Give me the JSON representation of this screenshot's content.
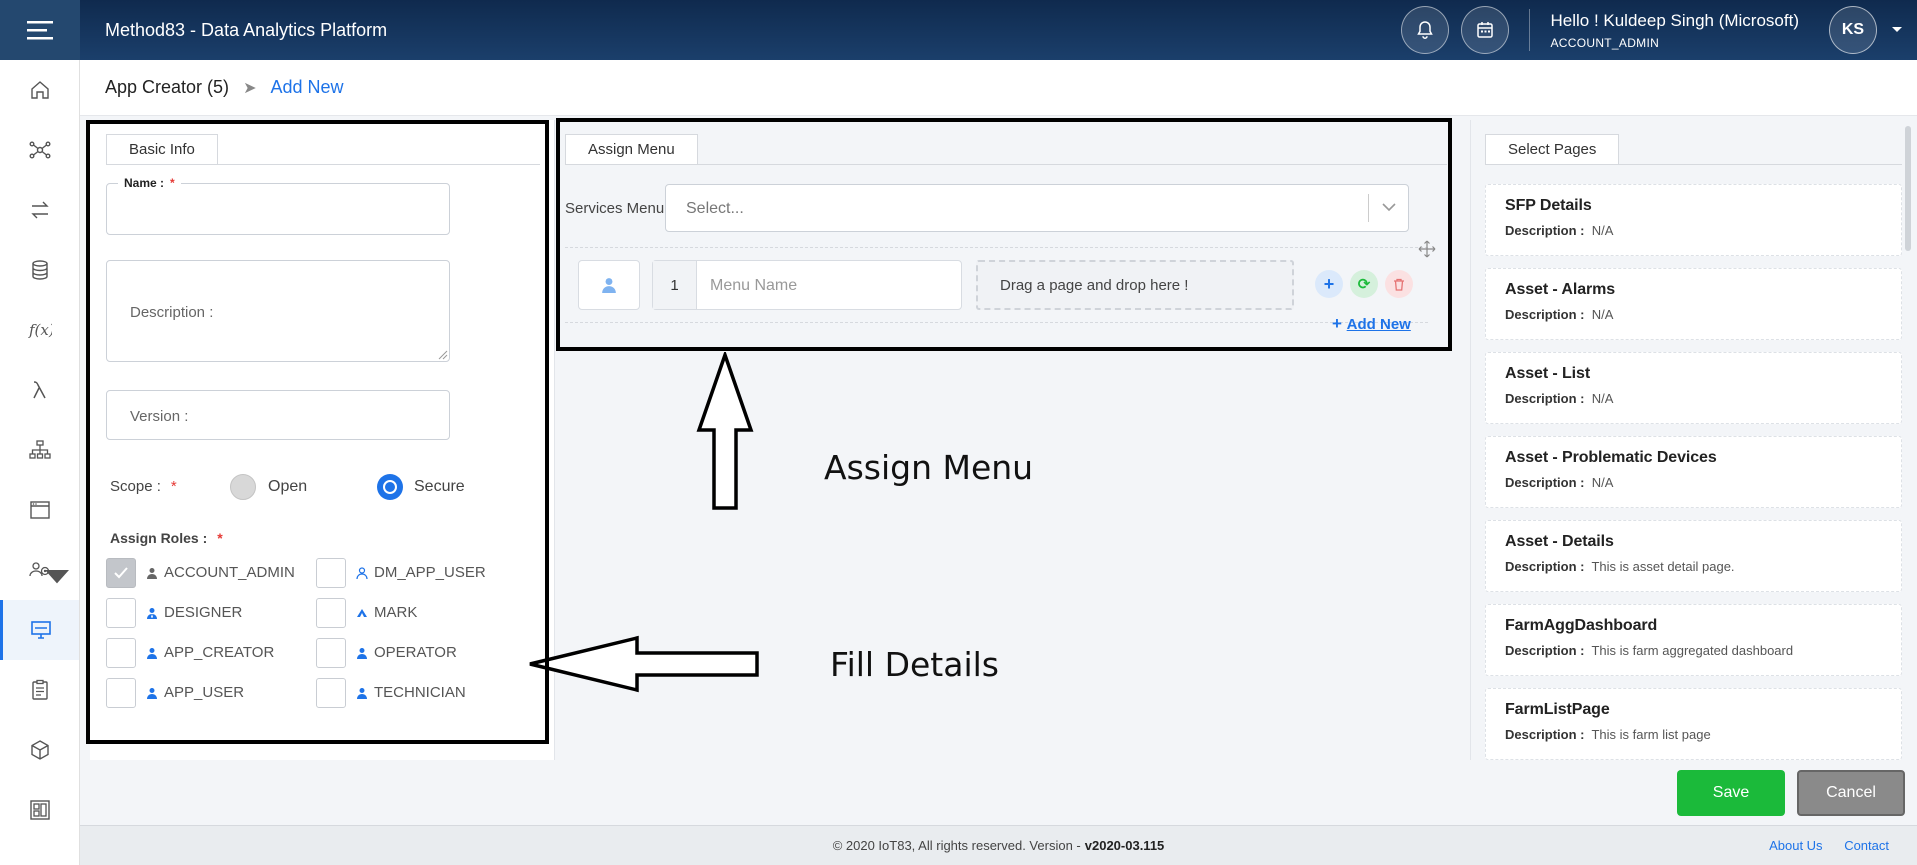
{
  "header": {
    "title": "Method83 - Data Analytics Platform",
    "greeting": "Hello ! Kuldeep Singh (Microsoft)",
    "role": "ACCOUNT_ADMIN",
    "avatar_initials": "KS"
  },
  "sidebar": {
    "items": [
      {
        "icon": "home-icon"
      },
      {
        "icon": "network-icon"
      },
      {
        "icon": "exchange-icon"
      },
      {
        "icon": "database-icon"
      },
      {
        "icon": "function-icon"
      },
      {
        "icon": "lambda-icon"
      },
      {
        "icon": "hierarchy-icon"
      },
      {
        "icon": "window-icon"
      },
      {
        "icon": "users-gear-icon"
      },
      {
        "icon": "monitor-icon",
        "active": true
      },
      {
        "icon": "clipboard-icon"
      },
      {
        "icon": "cube-icon"
      },
      {
        "icon": "layout-icon"
      }
    ]
  },
  "breadcrumb": {
    "parent": "App Creator (5)",
    "current": "Add New"
  },
  "basic_info": {
    "tab": "Basic Info",
    "name_label": "Name :",
    "name_value": "",
    "description_label": "Description :",
    "version_label": "Version :",
    "scope_label": "Scope :",
    "scope_options": [
      "Open",
      "Secure"
    ],
    "scope_selected": "Secure",
    "roles_label": "Assign Roles :",
    "roles": [
      {
        "name": "ACCOUNT_ADMIN",
        "checked": true
      },
      {
        "name": "DM_APP_USER",
        "checked": false
      },
      {
        "name": "DESIGNER",
        "checked": false
      },
      {
        "name": "MARK",
        "checked": false
      },
      {
        "name": "APP_CREATOR",
        "checked": false
      },
      {
        "name": "OPERATOR",
        "checked": false
      },
      {
        "name": "APP_USER",
        "checked": false
      },
      {
        "name": "TECHNICIAN",
        "checked": false
      }
    ]
  },
  "assign_menu": {
    "tab": "Assign Menu",
    "services_label": "Services Menu :",
    "services_placeholder": "Select...",
    "row_index": "1",
    "menu_name_placeholder": "Menu Name",
    "drop_text": "Drag a page and drop here !",
    "add_new": "Add New"
  },
  "select_pages": {
    "tab": "Select Pages",
    "desc_label": "Description :",
    "pages": [
      {
        "title": "SFP Details",
        "description": "N/A"
      },
      {
        "title": "Asset - Alarms",
        "description": "N/A"
      },
      {
        "title": "Asset - List",
        "description": "N/A"
      },
      {
        "title": "Asset - Problematic Devices",
        "description": "N/A"
      },
      {
        "title": "Asset - Details",
        "description": "This is asset detail page."
      },
      {
        "title": "FarmAggDashboard",
        "description": "This is farm aggregated dashboard"
      },
      {
        "title": "FarmListPage",
        "description": "This is farm list page"
      }
    ]
  },
  "annotations": {
    "assign_menu": "Assign Menu",
    "fill_details": "Fill Details"
  },
  "actions": {
    "save": "Save",
    "cancel": "Cancel"
  },
  "footer": {
    "copyright": "© 2020 IoT83, All rights reserved. Version -",
    "version": "v2020-03.115",
    "about": "About Us",
    "contact": "Contact"
  },
  "colors": {
    "header_bg": "#1b3f6b",
    "accent": "#1e73e8",
    "save": "#1bba3a",
    "cancel": "#8a8a8a",
    "required": "#e53935"
  }
}
